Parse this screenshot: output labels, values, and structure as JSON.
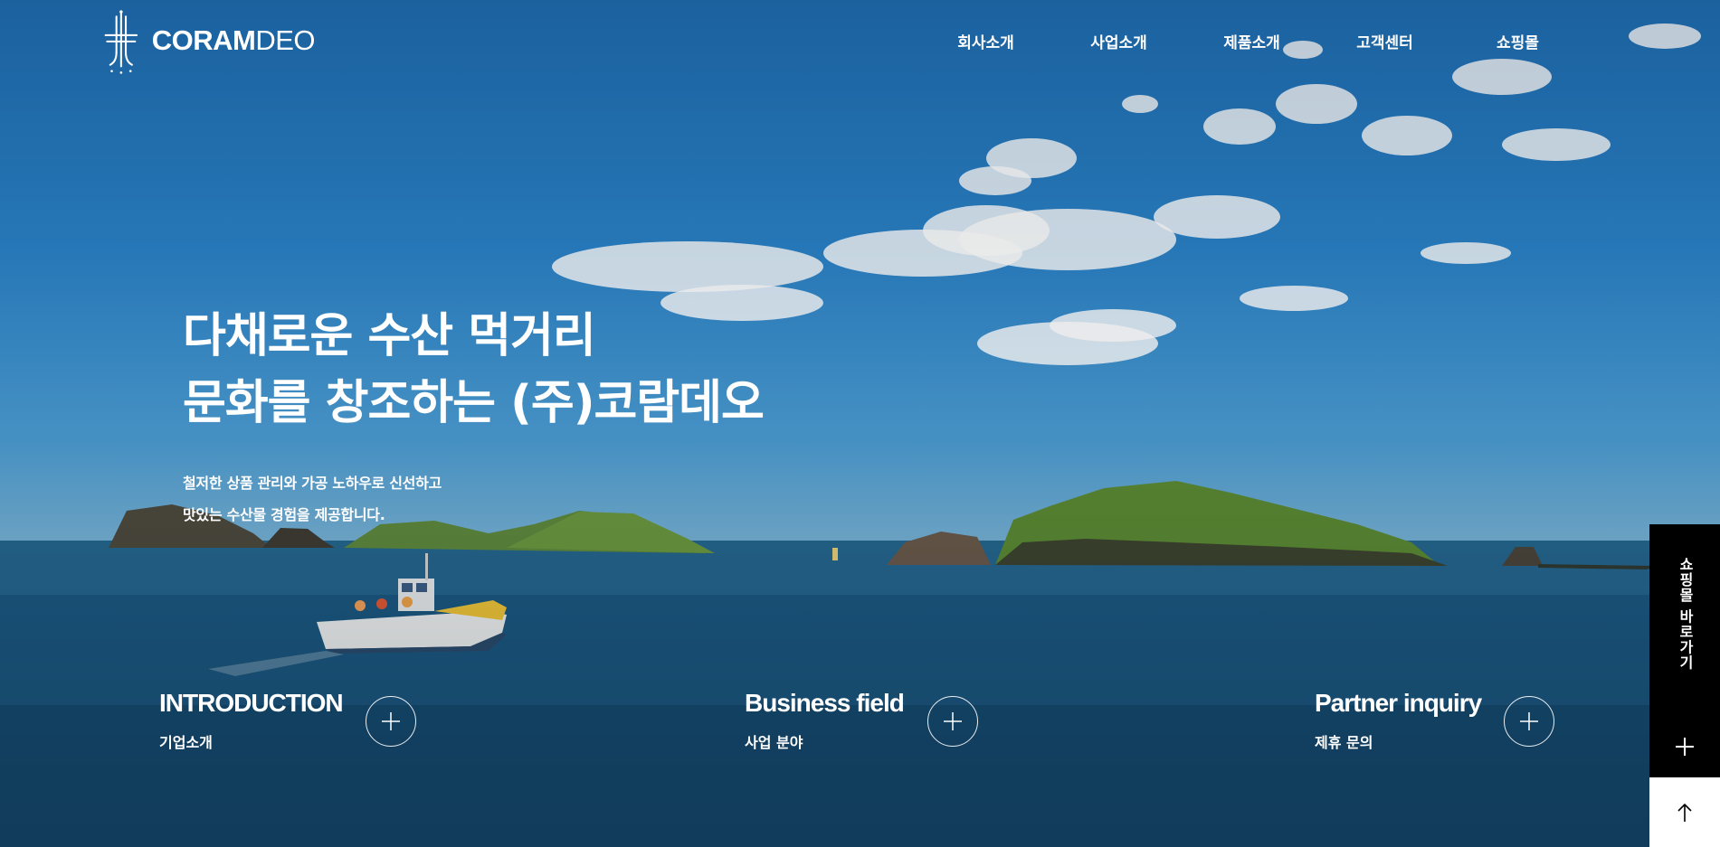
{
  "brand": {
    "logo_bold": "CORAM",
    "logo_light": "DEO"
  },
  "nav": {
    "items": [
      {
        "label": "회사소개"
      },
      {
        "label": "사업소개"
      },
      {
        "label": "제품소개"
      },
      {
        "label": "고객센터"
      },
      {
        "label": "쇼핑몰"
      }
    ]
  },
  "hero": {
    "title_line1": "다채로운 수산 먹거리",
    "title_line2": "문화를 창조하는 (주)코람데오",
    "sub_line1": "철저한 상품 관리와 가공 노하우로 신선하고",
    "sub_line2": "맛있는 수산물 경험을 제공합니다."
  },
  "features": [
    {
      "title": "INTRODUCTION",
      "desc": "기업소개",
      "icon": "plus-circle-icon"
    },
    {
      "title": "Business field",
      "desc": "사업 분야",
      "icon": "plus-circle-icon"
    },
    {
      "title": "Partner inquiry",
      "desc": "제휴 문의",
      "icon": "plus-circle-icon"
    }
  ],
  "side_panel": {
    "shop_label": "쇼핑몰 바로가기",
    "plus_icon": "plus-icon",
    "top_icon": "arrow-up-icon"
  },
  "colors": {
    "sky": "#2a82c8",
    "sea": "#1a4f77",
    "panel_dark": "#000000",
    "panel_light": "#ffffff",
    "text": "#ffffff"
  }
}
